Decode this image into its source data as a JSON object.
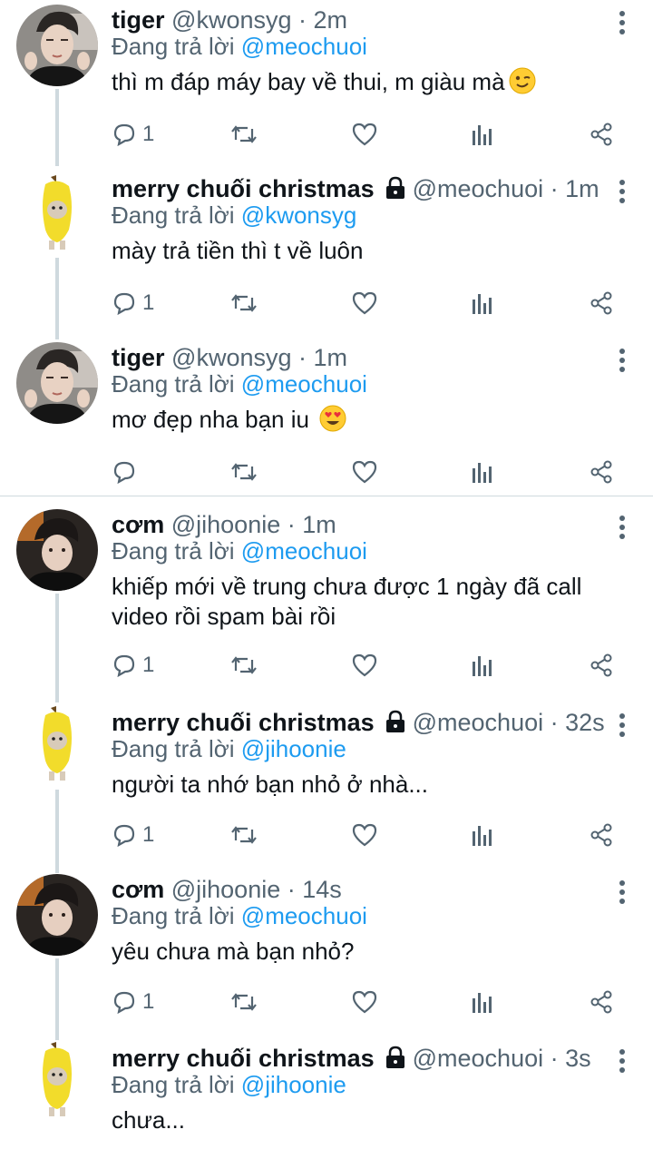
{
  "tweets": [
    {
      "name": "tiger",
      "handle": "@kwonsyg",
      "time": "2m",
      "reply_prefix": "Đang trả lời",
      "reply_to": "@meochuoi",
      "text": "thì m đáp máy bay về thui, m giàu mà",
      "emoji": "wink",
      "replies": "1",
      "avatar": "tiger",
      "locked": false
    },
    {
      "name": "merry chuối christmas",
      "handle": "@meochuoi",
      "time": "1m",
      "reply_prefix": "Đang trả lời",
      "reply_to": "@kwonsyg",
      "text": "mày trả tiền thì t về luôn",
      "emoji": "",
      "replies": "1",
      "avatar": "banana",
      "locked": true
    },
    {
      "name": "tiger",
      "handle": "@kwonsyg",
      "time": "1m",
      "reply_prefix": "Đang trả lời",
      "reply_to": "@meochuoi",
      "text": "mơ đẹp nha bạn iu ",
      "emoji": "heart-eyes",
      "replies": "",
      "avatar": "tiger",
      "locked": false
    },
    {
      "name": "cơm",
      "handle": "@jihoonie",
      "time": "1m",
      "reply_prefix": "Đang trả lời",
      "reply_to": "@meochuoi",
      "text": "khiếp mới về trung chưa được 1 ngày đã call video rồi spam bài rồi",
      "emoji": "",
      "replies": "1",
      "avatar": "com",
      "locked": false
    },
    {
      "name": "merry chuối christmas",
      "handle": "@meochuoi",
      "time": "32s",
      "reply_prefix": "Đang trả lời",
      "reply_to": "@jihoonie",
      "text": "người ta nhớ bạn nhỏ ở nhà...",
      "emoji": "",
      "replies": "1",
      "avatar": "banana",
      "locked": true
    },
    {
      "name": "cơm",
      "handle": "@jihoonie",
      "time": "14s",
      "reply_prefix": "Đang trả lời",
      "reply_to": "@meochuoi",
      "text": "yêu chưa mà bạn nhỏ?",
      "emoji": "",
      "replies": "1",
      "avatar": "com",
      "locked": false
    },
    {
      "name": "merry chuối christmas",
      "handle": "@meochuoi",
      "time": "3s",
      "reply_prefix": "Đang trả lời",
      "reply_to": "@jihoonie",
      "text": "chưa...",
      "emoji": "",
      "replies": "",
      "avatar": "banana",
      "locked": true
    }
  ],
  "icons": {
    "reply": "reply-icon",
    "retweet": "retweet-icon",
    "like": "heart-icon",
    "views": "analytics-icon",
    "share": "share-icon",
    "more": "more-vertical-icon",
    "lock": "lock-icon"
  },
  "colors": {
    "text": "#0f1419",
    "muted": "#536471",
    "accent": "#1d9bf0",
    "line": "#cfd9de"
  }
}
